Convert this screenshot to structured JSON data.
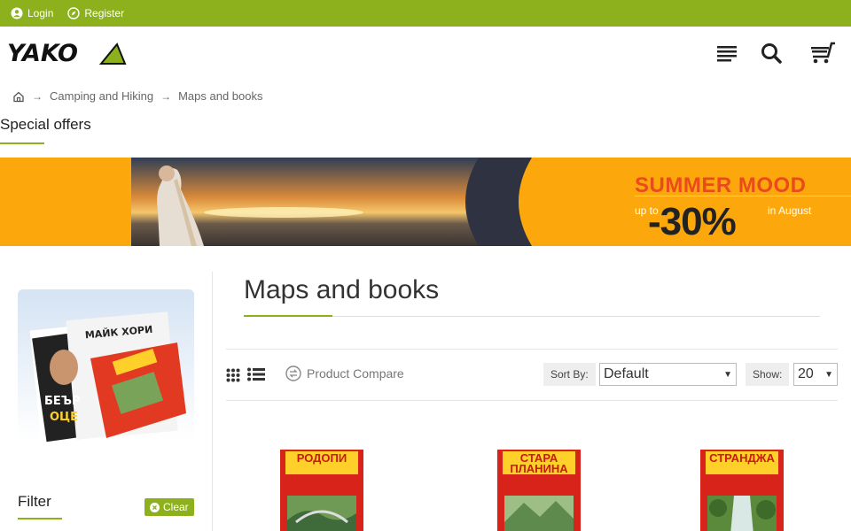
{
  "topbar": {
    "login": "Login",
    "register": "Register"
  },
  "header": {
    "logo_text": "YAKO"
  },
  "breadcrumb": {
    "items": [
      "Camping and Hiking",
      "Maps and books"
    ]
  },
  "special_offers": "Special offers",
  "banner": {
    "title": "SUMMER MOOD",
    "up_to": "up to",
    "discount": "-30%",
    "when": "in August"
  },
  "sidebar": {
    "filter_title": "Filter",
    "clear_label": "Clear"
  },
  "main": {
    "title": "Maps and books",
    "compare_label": "Product Compare",
    "sort_label": "Sort By:",
    "sort_value": "Default",
    "show_label": "Show:",
    "show_value": "20"
  },
  "products": [
    {
      "title": "РОДОПИ"
    },
    {
      "title": "СТАРА ПЛАНИНА"
    },
    {
      "title": "СТРАНДЖА"
    }
  ],
  "colors": {
    "accent": "#8db11d",
    "banner": "#fca80c",
    "banner_title": "#e94b1c"
  }
}
